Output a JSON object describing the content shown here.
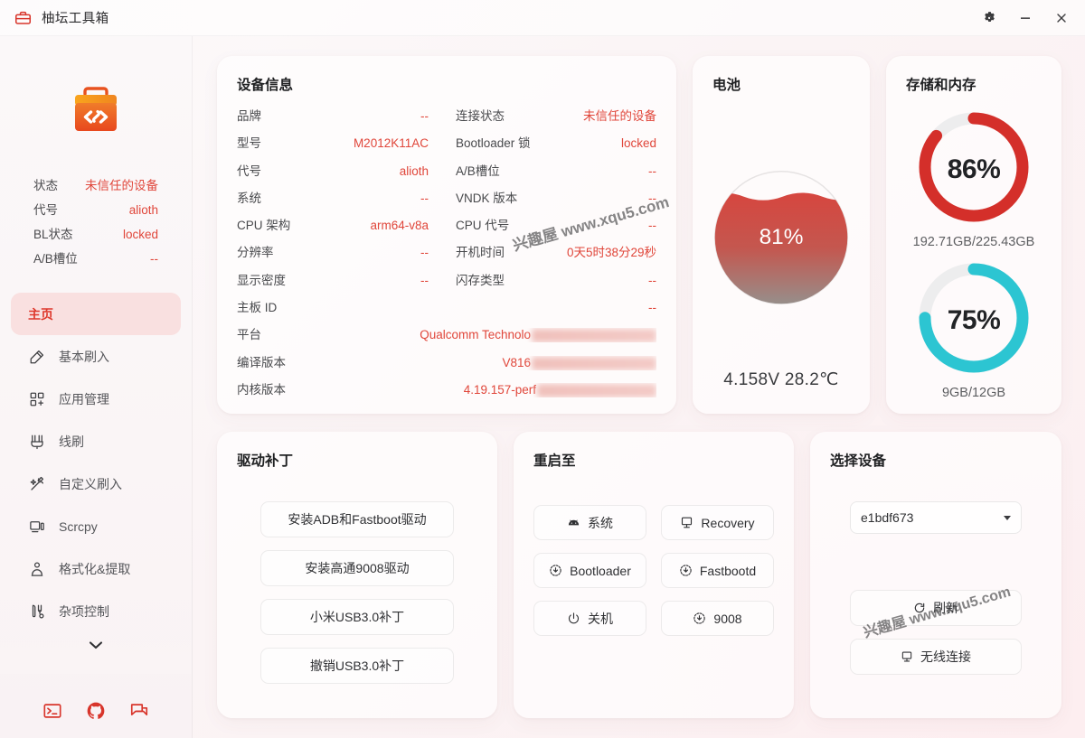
{
  "window": {
    "title": "柚坛工具箱",
    "icon": "toolbox-icon",
    "controls": {
      "settings": "gear-icon",
      "minimize": "minimize-icon",
      "close": "close-icon"
    }
  },
  "sidebar": {
    "logo": "toolbox-code-logo",
    "summary": [
      {
        "key": "状态",
        "value": "未信任的设备"
      },
      {
        "key": "代号",
        "value": "alioth"
      },
      {
        "key": "BL状态",
        "value": "locked"
      },
      {
        "key": "A/B槽位",
        "value": "--"
      }
    ],
    "nav": [
      {
        "label": "主页",
        "icon": "home-icon",
        "active": true
      },
      {
        "label": "基本刷入",
        "icon": "flash-icon",
        "active": false
      },
      {
        "label": "应用管理",
        "icon": "apps-icon",
        "active": false
      },
      {
        "label": "线刷",
        "icon": "cable-icon",
        "active": false
      },
      {
        "label": "自定义刷入",
        "icon": "wand-icon",
        "active": false
      },
      {
        "label": "Scrcpy",
        "icon": "screen-icon",
        "active": false
      },
      {
        "label": "格式化&提取",
        "icon": "extract-icon",
        "active": false
      },
      {
        "label": "杂项控制",
        "icon": "tools-icon",
        "active": false
      }
    ],
    "scroll_indicator": "chevron-down-icon",
    "footer_icons": [
      "terminal-icon",
      "github-icon",
      "forum-icon"
    ]
  },
  "device_info": {
    "title": "设备信息",
    "left": [
      {
        "label": "品牌",
        "value": "--"
      },
      {
        "label": "型号",
        "value": "M2012K11AC"
      },
      {
        "label": "代号",
        "value": "alioth"
      },
      {
        "label": "系统",
        "value": "--"
      },
      {
        "label": "CPU 架构",
        "value": "arm64-v8a"
      },
      {
        "label": "分辨率",
        "value": "--"
      },
      {
        "label": "显示密度",
        "value": "--"
      }
    ],
    "right": [
      {
        "label": "连接状态",
        "value": "未信任的设备"
      },
      {
        "label": "Bootloader 锁",
        "value": "locked"
      },
      {
        "label": "A/B槽位",
        "value": "--"
      },
      {
        "label": "VNDK 版本",
        "value": "--"
      },
      {
        "label": "CPU 代号",
        "value": "--"
      },
      {
        "label": "开机时间",
        "value": "0天5时38分29秒"
      },
      {
        "label": "闪存类型",
        "value": "--"
      }
    ],
    "wide": [
      {
        "label": "主板 ID",
        "value": "--",
        "censored": 0
      },
      {
        "label": "平台",
        "value": "Qualcomm Technolo",
        "censored": 138
      },
      {
        "label": "编译版本",
        "value": "V816",
        "censored": 138
      },
      {
        "label": "内核版本",
        "value": "4.19.157-perf",
        "censored": 132
      }
    ]
  },
  "battery": {
    "title": "电池",
    "percent": "81%",
    "percent_value": 81,
    "footer": "4.158V 28.2℃"
  },
  "storage": {
    "title": "存储和内存",
    "rings": [
      {
        "percent": "86%",
        "value": 86,
        "sub": "192.71GB/225.43GB",
        "color": "#d42f2a"
      },
      {
        "percent": "75%",
        "value": 75,
        "sub": "9GB/12GB",
        "color": "#2cc5d2"
      }
    ]
  },
  "driver": {
    "title": "驱动补丁",
    "buttons": [
      {
        "label": "安装ADB和Fastboot驱动"
      },
      {
        "label": "安装高通9008驱动"
      },
      {
        "label": "小米USB3.0补丁"
      },
      {
        "label": "撤销USB3.0补丁"
      }
    ]
  },
  "reboot": {
    "title": "重启至",
    "buttons": [
      {
        "label": "系统",
        "icon": "android-icon"
      },
      {
        "label": "Recovery",
        "icon": "recovery-icon"
      },
      {
        "label": "Bootloader",
        "icon": "download-circle-icon"
      },
      {
        "label": "Fastbootd",
        "icon": "download-circle-icon"
      },
      {
        "label": "关机",
        "icon": "power-icon"
      },
      {
        "label": "9008",
        "icon": "download-circle-icon"
      }
    ]
  },
  "device_select": {
    "title": "选择设备",
    "selected": "e1bdf673",
    "dropdown_icon": "chevron-down-icon",
    "actions": [
      {
        "label": "刷新",
        "icon": "refresh-icon"
      },
      {
        "label": "无线连接",
        "icon": "wireless-icon"
      }
    ]
  },
  "watermarks": [
    "兴趣屋 www.xqu5.com",
    "兴趣屋 www.xqu5.com"
  ],
  "colors": {
    "accent_red": "#e0463a",
    "ring_red": "#d42f2a",
    "ring_teal": "#2cc5d2",
    "ring_track": "#ededee",
    "active_nav_bg": "#f9e0e0"
  }
}
